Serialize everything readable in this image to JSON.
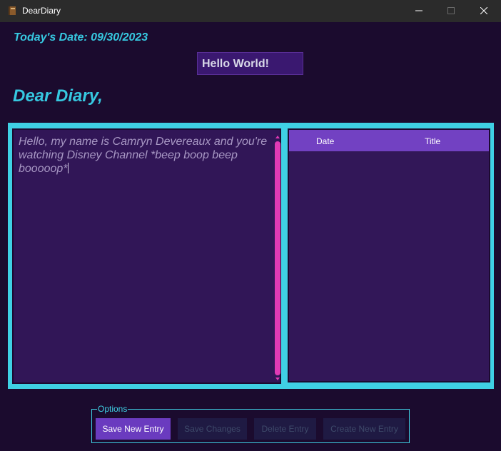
{
  "window": {
    "title": "DearDiary",
    "icon": "book-icon"
  },
  "header": {
    "date_label": "Today's Date: 09/30/2023",
    "entry_title": "Hello World!",
    "greeting": "Dear Diary,"
  },
  "editor": {
    "text": "Hello, my name is Camryn Devereaux and you're watching Disney Channel *beep boop beep booooop*"
  },
  "entries_table": {
    "columns": [
      "Date",
      "Title"
    ],
    "rows": []
  },
  "options": {
    "legend": "Options",
    "save_new": "Save New Entry",
    "save_changes": "Save Changes",
    "delete": "Delete Entry",
    "create_new": "Create New Entry"
  },
  "colors": {
    "background": "#1b0b2e",
    "accent_cyan": "#3fd0e4",
    "accent_purple": "#7241c2",
    "scrollbar_pink": "#e03ab5"
  }
}
